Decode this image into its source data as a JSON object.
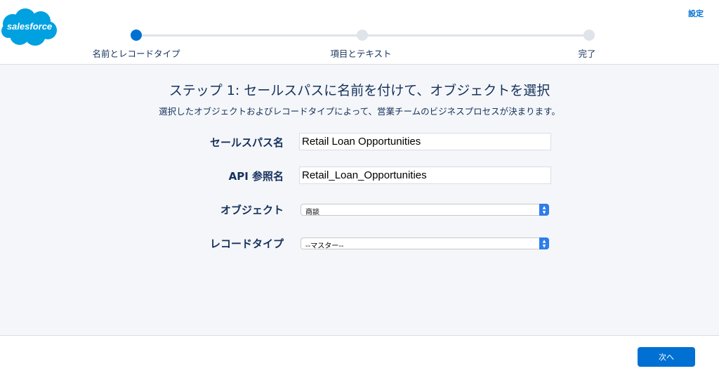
{
  "app": {
    "logo_text": "salesforce",
    "settings_label": "設定",
    "brand_color": "#00a1e0",
    "accent_color": "#0070d2"
  },
  "progress": {
    "current_step": 1,
    "fill_fraction": 0.0,
    "steps": [
      {
        "label": "名前とレコードタイプ",
        "state": "active"
      },
      {
        "label": "項目とテキスト",
        "state": "inactive"
      },
      {
        "label": "完了",
        "state": "inactive"
      }
    ]
  },
  "main": {
    "title": "ステップ 1: セールスパスに名前を付けて、オブジェクトを選択",
    "description": "選択したオブジェクトおよびレコードタイプによって、営業チームのビジネスプロセスが決まります。"
  },
  "form": {
    "path_name": {
      "label": "セールスパス名",
      "value": "Retail Loan Opportunities"
    },
    "api_name": {
      "label": "API 参照名",
      "value": "Retail_Loan_Opportunities"
    },
    "object": {
      "label": "オブジェクト",
      "selected": "商談"
    },
    "record_type": {
      "label": "レコードタイプ",
      "selected": "--マスター--"
    }
  },
  "footer": {
    "next_label": "次へ"
  }
}
